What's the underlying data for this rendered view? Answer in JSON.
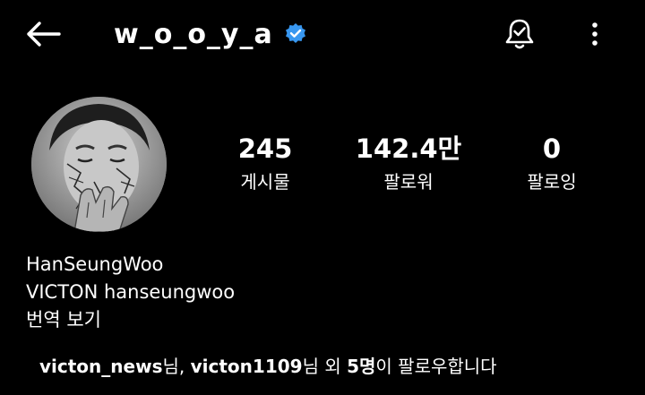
{
  "header": {
    "username": "w_o_o_y_a",
    "verified": true,
    "accent_color": "#3897f0",
    "icons": [
      "back-arrow-icon",
      "verified-badge-icon",
      "notification-bell-icon",
      "more-options-icon"
    ]
  },
  "stats": [
    {
      "value": "245",
      "label": "게시물"
    },
    {
      "value": "142.4만",
      "label": "팔로워"
    },
    {
      "value": "0",
      "label": "팔로잉"
    }
  ],
  "bio": {
    "name": "HanSeungWoo",
    "description": "VICTON hanseungwoo",
    "translate": "번역 보기"
  },
  "followed_by": {
    "user1": "victon_news",
    "sep1": "님, ",
    "user2": "victon1109",
    "sep2": "님 외 ",
    "count": "5명",
    "suffix": "이 팔로우합니다"
  }
}
